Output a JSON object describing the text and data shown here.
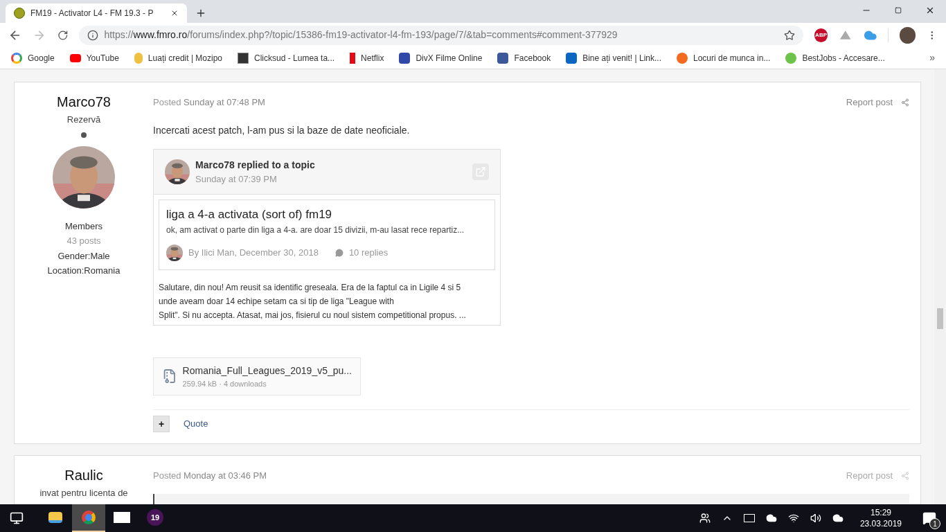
{
  "browser": {
    "tab": {
      "title": "FM19 - Activator L4 - FM 19.3 - P"
    },
    "url": {
      "host": "https://www.fmro.ro",
      "path": "/forums/index.php?/topic/15386-fm19-activator-l4-fm-193/page/7/&tab=comments#comment-377929"
    },
    "extensions": [
      {
        "kind": "abp",
        "label": "ABP"
      },
      {
        "kind": "drive"
      },
      {
        "kind": "cloud"
      }
    ],
    "bookmarks": [
      {
        "kind": "google",
        "label": "Google"
      },
      {
        "kind": "youtube",
        "label": "YouTube"
      },
      {
        "kind": "coin",
        "label": "Luați credit | Mozipo"
      },
      {
        "kind": "box",
        "label": "Clicksud - Lumea ta..."
      },
      {
        "kind": "netflix",
        "label": "Netflix"
      },
      {
        "kind": "clapper",
        "label": "DivX Filme Online"
      },
      {
        "kind": "facebook",
        "label": "Facebook"
      },
      {
        "kind": "linkedin",
        "label": "Bine ați venit! | Link..."
      },
      {
        "kind": "orange",
        "label": "Locuri de munca in..."
      },
      {
        "kind": "green",
        "label": "BestJobs - Accesare..."
      }
    ],
    "more": "»"
  },
  "posts": [
    {
      "author": "Marco78",
      "rank": "Rezervă",
      "group": "Members",
      "posts": "43 posts",
      "gender": "Gender:Male",
      "location": "Location:Romania",
      "has_avatar": true,
      "posted": "Posted",
      "date": "Sunday at 07:48 PM",
      "report": "Report post",
      "body": "Incercati acest patch, l-am pus si la baze de date neoficiale.",
      "embed": {
        "header": "Marco78 replied to a topic",
        "time": "Sunday at 07:39 PM",
        "topic_title": "liga a 4-a activata (sort of) fm19",
        "topic_excerpt": "ok, am activat o parte din liga a 4-a. are doar 15 divizii, m-au lasat rece repartiz...",
        "topic_by": "By Ilici Man, December 30, 2018",
        "replies": "10 replies",
        "content": [
          "Salutare, din nou!  Am reusit sa identific greseala. Era de la faptul ca in Ligile 4 si 5",
          "unde aveam doar 14 echipe setam ca si tip de liga \"League with",
          "Split\". Si nu accepta.  Atasat, mai jos, fisierul cu noul sistem competitional propus. ..."
        ]
      },
      "attachment": {
        "name": "Romania_Full_Leagues_2019_v5_pu...",
        "meta": "259.94 kB · 4 downloads"
      },
      "actions": {
        "plus": "+",
        "quote": "Quote"
      }
    },
    {
      "author": "Raulic",
      "rank": "invat pentru licenta de",
      "posted": "Posted",
      "date": "Monday at 03:46 PM",
      "report": "Report post",
      "has_avatar": false,
      "quote_box": true
    }
  ],
  "taskbar": {
    "apps": [
      {
        "kind": "explorer",
        "selected": false
      },
      {
        "kind": "chrome",
        "selected": true
      },
      {
        "kind": "mail",
        "selected": false
      },
      {
        "kind": "fm",
        "label": "19",
        "selected": false
      }
    ],
    "time": "15:29",
    "date": "23.03.2019",
    "notifications": "1"
  }
}
